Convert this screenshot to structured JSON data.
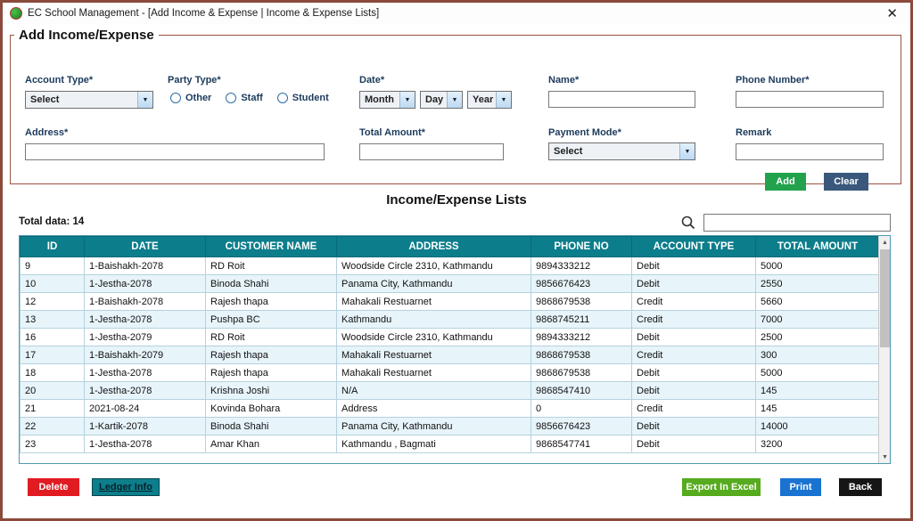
{
  "window": {
    "title": "EC School Management - [Add Income & Expense | Income & Expense Lists]",
    "close_label": "✕"
  },
  "form": {
    "legend": "Add Income/Expense",
    "fields": {
      "account_type": {
        "label": "Account Type*",
        "value": "Select"
      },
      "party_type": {
        "label": "Party Type*",
        "options": [
          "Other",
          "Staff",
          "Student"
        ]
      },
      "date": {
        "label": "Date*",
        "month": "Month",
        "day": "Day",
        "year": "Year"
      },
      "name": {
        "label": "Name*",
        "value": ""
      },
      "phone": {
        "label": "Phone Number*",
        "value": ""
      },
      "address": {
        "label": "Address*",
        "value": ""
      },
      "total_amount": {
        "label": "Total Amount*",
        "value": ""
      },
      "payment_mode": {
        "label": "Payment Mode*",
        "value": "Select"
      },
      "remark": {
        "label": "Remark",
        "value": ""
      }
    },
    "buttons": {
      "add": "Add",
      "clear": "Clear"
    }
  },
  "list": {
    "title": "Income/Expense Lists",
    "total_label": "Total data: 14",
    "search_value": ""
  },
  "table": {
    "columns": [
      "ID",
      "DATE",
      "CUSTOMER NAME",
      "ADDRESS",
      "PHONE NO",
      "ACCOUNT TYPE",
      "TOTAL AMOUNT"
    ],
    "rows": [
      [
        "9",
        "1-Baishakh-2078",
        "RD Roit",
        "Woodside Circle 2310, Kathmandu",
        "9894333212",
        "Debit",
        "5000"
      ],
      [
        "10",
        "1-Jestha-2078",
        "Binoda Shahi",
        "Panama City, Kathmandu",
        "9856676423",
        "Debit",
        "2550"
      ],
      [
        "12",
        "1-Baishakh-2078",
        "Rajesh thapa",
        "Mahakali Restuarnet",
        "9868679538",
        "Credit",
        "5660"
      ],
      [
        "13",
        "1-Jestha-2078",
        "Pushpa BC",
        "Kathmandu",
        "9868745211",
        "Credit",
        "7000"
      ],
      [
        "16",
        "1-Jestha-2079",
        "RD Roit",
        "Woodside Circle 2310, Kathmandu",
        "9894333212",
        "Debit",
        "2500"
      ],
      [
        "17",
        "1-Baishakh-2079",
        "Rajesh thapa",
        "Mahakali Restuarnet",
        "9868679538",
        "Credit",
        "300"
      ],
      [
        "18",
        "1-Jestha-2078",
        "Rajesh thapa",
        "Mahakali Restuarnet",
        "9868679538",
        "Debit",
        "5000"
      ],
      [
        "20",
        "1-Jestha-2078",
        "Krishna Joshi",
        "N/A",
        "9868547410",
        "Debit",
        "145"
      ],
      [
        "21",
        "2021-08-24",
        "Kovinda Bohara",
        "Address",
        "0",
        "Credit",
        "145"
      ],
      [
        "22",
        "1-Kartik-2078",
        "Binoda Shahi",
        "Panama City, Kathmandu",
        "9856676423",
        "Debit",
        "14000"
      ],
      [
        "23",
        "1-Jestha-2078",
        "Amar Khan",
        "Kathmandu , Bagmati",
        "9868547741",
        "Debit",
        "3200"
      ]
    ]
  },
  "footer": {
    "delete": "Delete",
    "ledger_info": "Ledger Info",
    "export_excel": "Export In Excel",
    "print": "Print",
    "back": "Back"
  },
  "colors": {
    "window_border": "#8a4a3c",
    "table_header_teal": "#0c7d8b",
    "row_alt_blue": "#e7f4fa",
    "add_green": "#22a24c",
    "clear_blue": "#39587c",
    "delete_red": "#e01b22",
    "excel_green": "#56ab1e",
    "print_blue": "#1a73d1",
    "back_black": "#151515"
  }
}
